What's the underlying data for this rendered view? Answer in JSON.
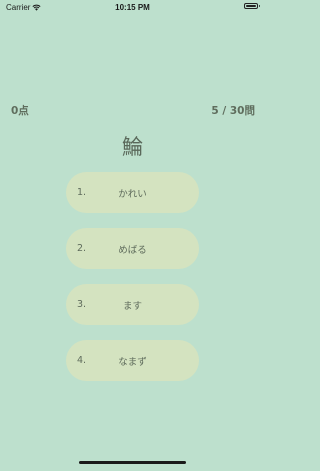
{
  "status_bar": {
    "carrier": "Carrier",
    "time": "10:15 PM",
    "icons": [
      "wifi-icon",
      "battery-icon"
    ]
  },
  "header": {
    "score": "0点",
    "progress": "5 / 30問"
  },
  "question": {
    "kanji": "鯩"
  },
  "choices": [
    {
      "number": "1.",
      "text": "かれい"
    },
    {
      "number": "2.",
      "text": "めばる"
    },
    {
      "number": "3.",
      "text": "ます"
    },
    {
      "number": "4.",
      "text": "なまず"
    }
  ],
  "colors": {
    "background": "#bde0cd",
    "choice_button": "#d4e3c0",
    "text": "#5f6c5c"
  }
}
